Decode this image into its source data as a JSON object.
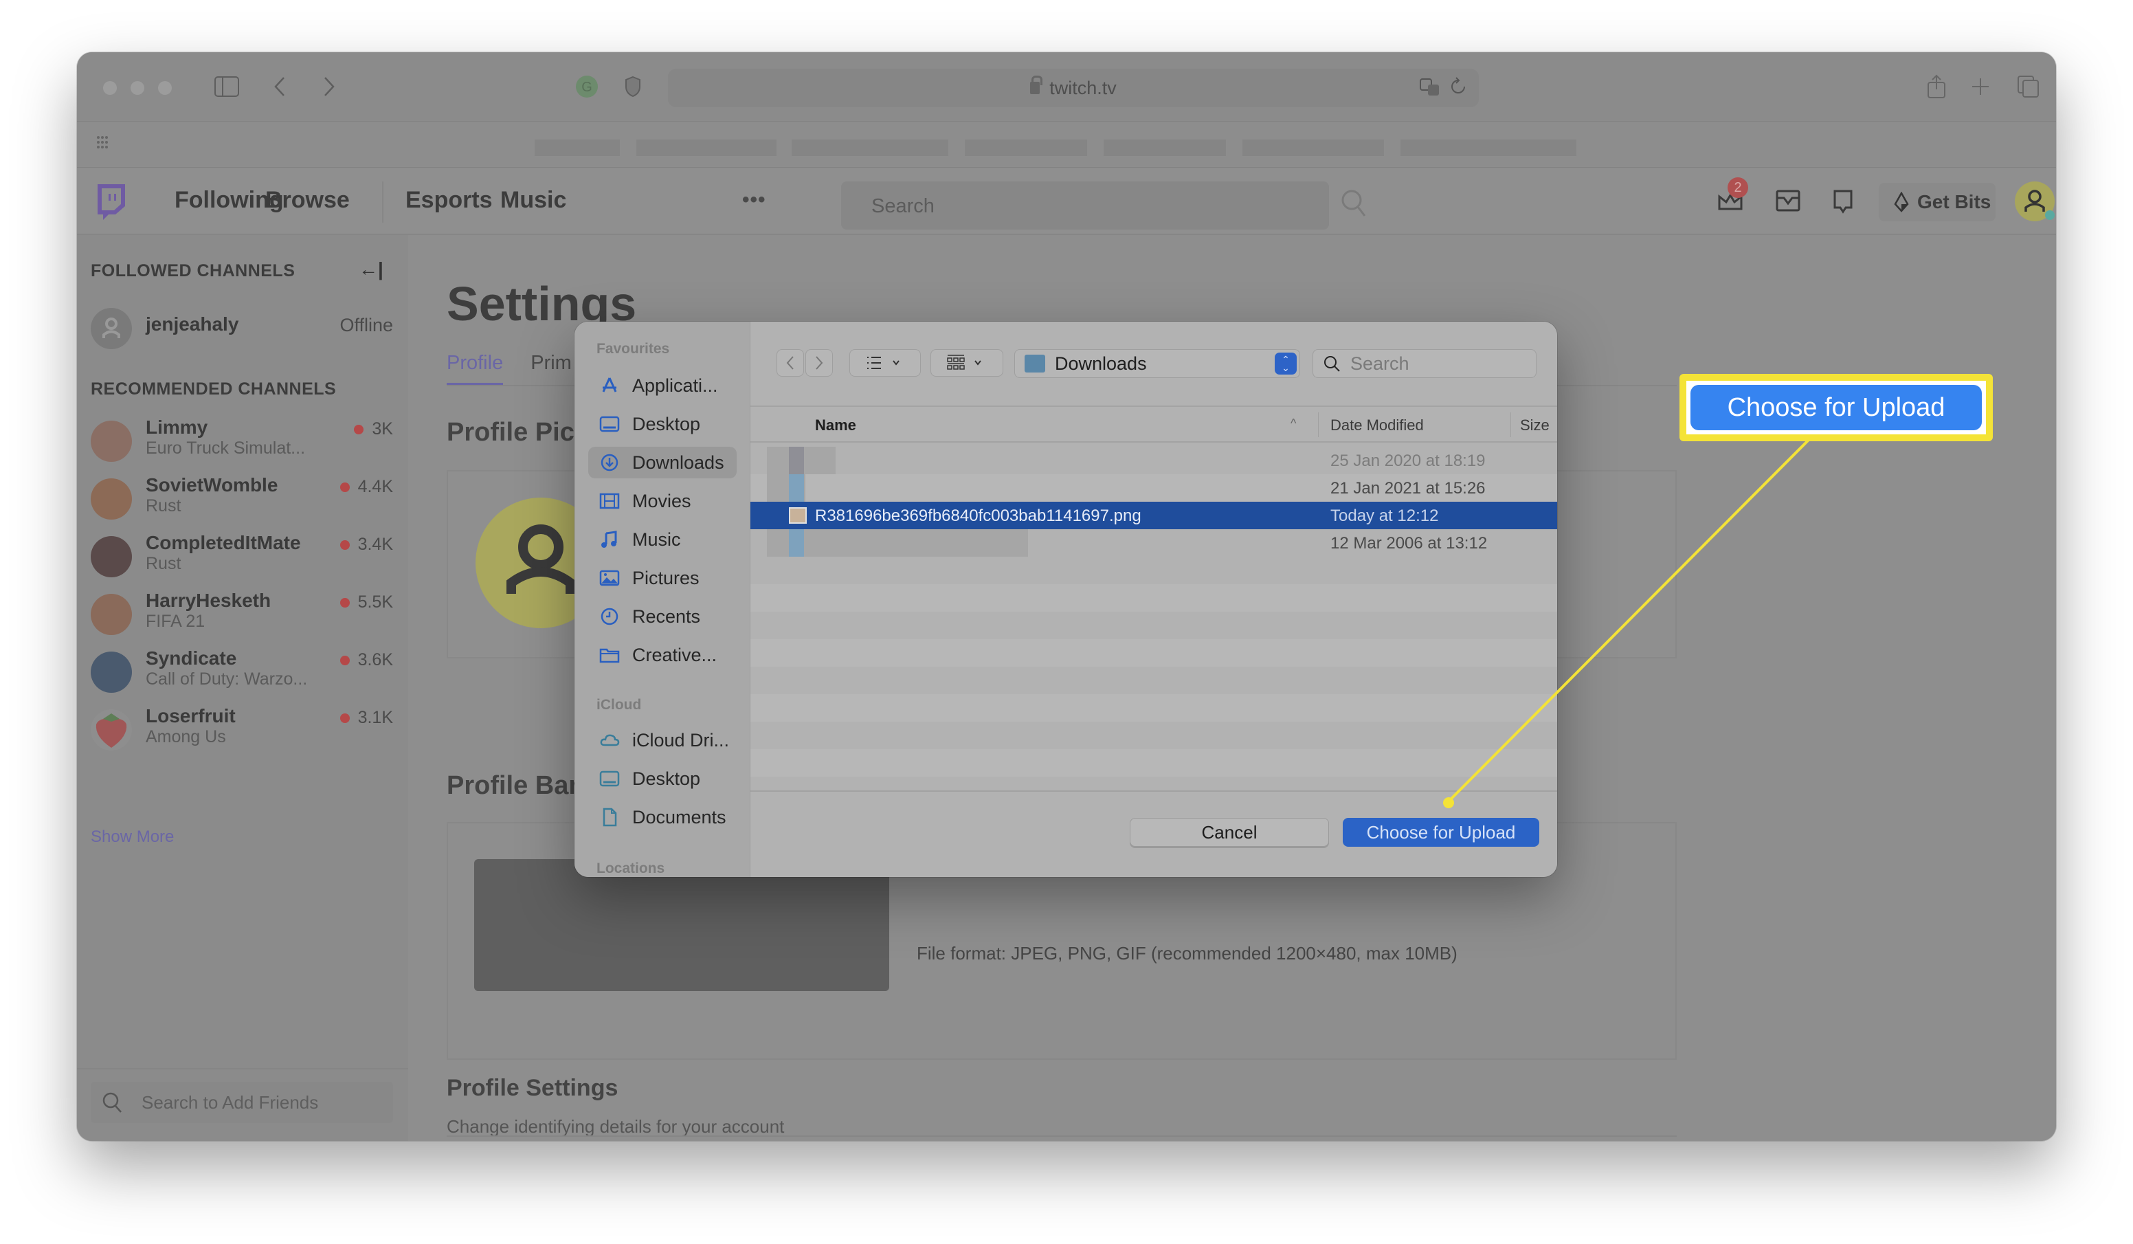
{
  "browser": {
    "url": "twitch.tv",
    "icons": [
      "sidebar-toggle-icon",
      "back-icon",
      "forward-icon",
      "grammarly-icon",
      "shield-icon",
      "translate-icon",
      "reload-icon",
      "share-icon",
      "new-tab-icon",
      "tab-overview-icon",
      "apps-grid-icon"
    ]
  },
  "twitch_nav": {
    "links": [
      "Following",
      "Browse",
      "Esports",
      "Music"
    ],
    "more": "•••",
    "search_placeholder": "Search",
    "notification_count": "2",
    "get_bits": "Get Bits",
    "accent_color": "#9146ff"
  },
  "sidebar": {
    "followed_heading": "FOLLOWED CHANNELS",
    "followed": [
      {
        "name": "jenjeahaly",
        "status": "Offline"
      }
    ],
    "recommended_heading": "RECOMMENDED CHANNELS",
    "recommended": [
      {
        "name": "Limmy",
        "game": "Euro Truck Simulat...",
        "viewers": "3K"
      },
      {
        "name": "SovietWomble",
        "game": "Rust",
        "viewers": "4.4K"
      },
      {
        "name": "CompletedItMate",
        "game": "Rust",
        "viewers": "3.4K"
      },
      {
        "name": "HarryHesketh",
        "game": "FIFA 21",
        "viewers": "5.5K"
      },
      {
        "name": "Syndicate",
        "game": "Call of Duty: Warzo...",
        "viewers": "3.6K"
      },
      {
        "name": "Loserfruit",
        "game": "Among Us",
        "viewers": "3.1K"
      }
    ],
    "show_more": "Show More",
    "friend_search_placeholder": "Search to Add Friends"
  },
  "settings": {
    "title": "Settings",
    "tabs": [
      {
        "label": "Profile",
        "active": true
      },
      {
        "label": "Prim",
        "active": false
      }
    ],
    "profile_picture_title": "Profile Pict",
    "profile_banner_title": "Profile Ban",
    "banner_file_format": "File format: JPEG, PNG, GIF (recommended 1200×480, max 10MB)",
    "profile_settings_title": "Profile Settings",
    "profile_settings_desc": "Change identifying details for your account"
  },
  "file_dialog": {
    "sidebar": {
      "favourites_heading": "Favourites",
      "favourites": [
        {
          "label": "Applicati...",
          "icon": "applications-icon"
        },
        {
          "label": "Desktop",
          "icon": "desktop-icon"
        },
        {
          "label": "Downloads",
          "icon": "downloads-icon",
          "selected": true
        },
        {
          "label": "Movies",
          "icon": "movies-icon"
        },
        {
          "label": "Music",
          "icon": "music-icon"
        },
        {
          "label": "Pictures",
          "icon": "pictures-icon"
        },
        {
          "label": "Recents",
          "icon": "recents-icon"
        },
        {
          "label": "Creative...",
          "icon": "folder-icon"
        }
      ],
      "icloud_heading": "iCloud",
      "icloud": [
        {
          "label": "iCloud Dri...",
          "icon": "icloud-icon"
        },
        {
          "label": "Desktop",
          "icon": "desktop-icon"
        },
        {
          "label": "Documents",
          "icon": "document-icon"
        }
      ],
      "locations_heading": "Locations"
    },
    "location": "Downloads",
    "search_placeholder": "Search",
    "columns": {
      "name": "Name",
      "date_modified": "Date Modified",
      "size": "Size"
    },
    "files": [
      {
        "name": "",
        "date": "25 Jan 2020 at 18:19",
        "blurred": true,
        "faded": true
      },
      {
        "name": "",
        "date": "21 Jan 2021 at 15:26",
        "blurred": true
      },
      {
        "name": "R381696be369fb6840fc003bab1141697.png",
        "date": "Today at 12:12",
        "selected": true
      },
      {
        "name": "",
        "date": "12 Mar 2006 at 13:12",
        "blurred": true
      }
    ],
    "cancel_label": "Cancel",
    "choose_label": "Choose for Upload"
  },
  "annotation": {
    "label": "Choose for Upload",
    "highlight_color": "#f4e337",
    "button_color": "#3684f0"
  }
}
